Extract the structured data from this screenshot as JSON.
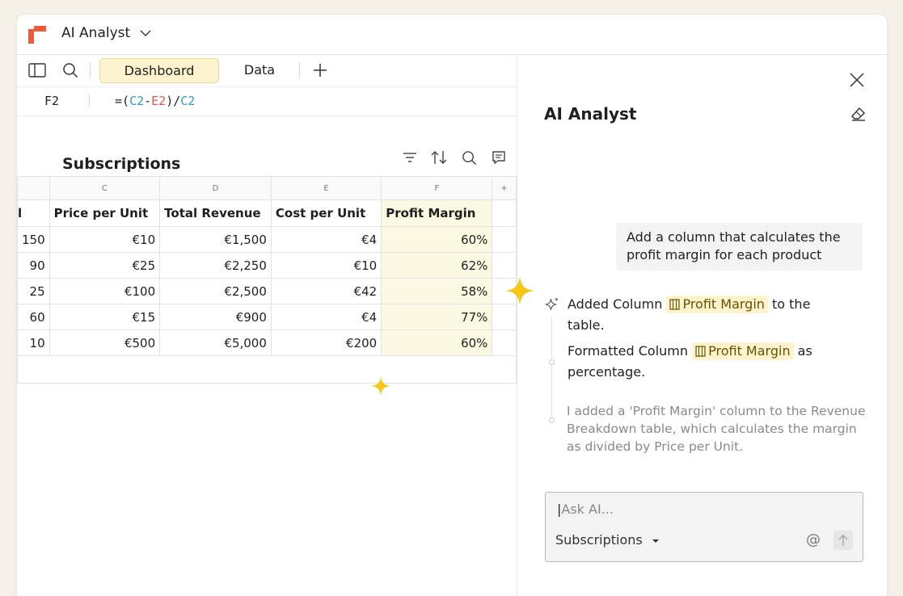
{
  "app": {
    "title": "AI Analyst"
  },
  "toolbar": {
    "tabs": [
      {
        "label": "Dashboard",
        "active": true
      },
      {
        "label": "Data",
        "active": false
      }
    ]
  },
  "formula_bar": {
    "cell": "F2",
    "formula": {
      "open": "=(",
      "ref1": "C2",
      "op": "-",
      "ref2": "E2",
      "close": ")/",
      "ref3": "C2"
    }
  },
  "table": {
    "title": "Subscriptions",
    "column_letters": [
      "",
      "C",
      "D",
      "E",
      "F",
      "+"
    ],
    "headers": [
      "l",
      "Price per Unit",
      "Total Revenue",
      "Cost per Unit",
      "Profit Margin",
      ""
    ],
    "rows": [
      [
        "150",
        "€10",
        "€1,500",
        "€4",
        "60%"
      ],
      [
        "90",
        "€25",
        "€2,250",
        "€10",
        "62%"
      ],
      [
        "25",
        "€100",
        "€2,500",
        "€42",
        "58%"
      ],
      [
        "60",
        "€15",
        "€900",
        "€4",
        "77%"
      ],
      [
        "10",
        "€500",
        "€5,000",
        "€200",
        "60%"
      ]
    ]
  },
  "panel": {
    "title": "AI Analyst",
    "user_message": "Add a column that calculates the profit margin for each product",
    "actions": [
      {
        "pre": "Added Column",
        "chip": "Profit Margin",
        "post": "to the",
        "line2": "table."
      },
      {
        "pre": "Formatted Column",
        "chip": "Profit Margin",
        "post": "as",
        "line2": "percentage."
      }
    ],
    "summary": "I added a 'Profit Margin' column to the Revenue Breakdown table, which calculates the margin as divided by Price per Unit.",
    "input_placeholder": "Ask AI...",
    "context_selector": "Subscriptions",
    "mention_symbol": "@"
  },
  "colors": {
    "accent": "#f0d98a",
    "highlight": "#fdf8e1",
    "brand": "#ef5a3c",
    "sparkle": "#f5c518"
  }
}
